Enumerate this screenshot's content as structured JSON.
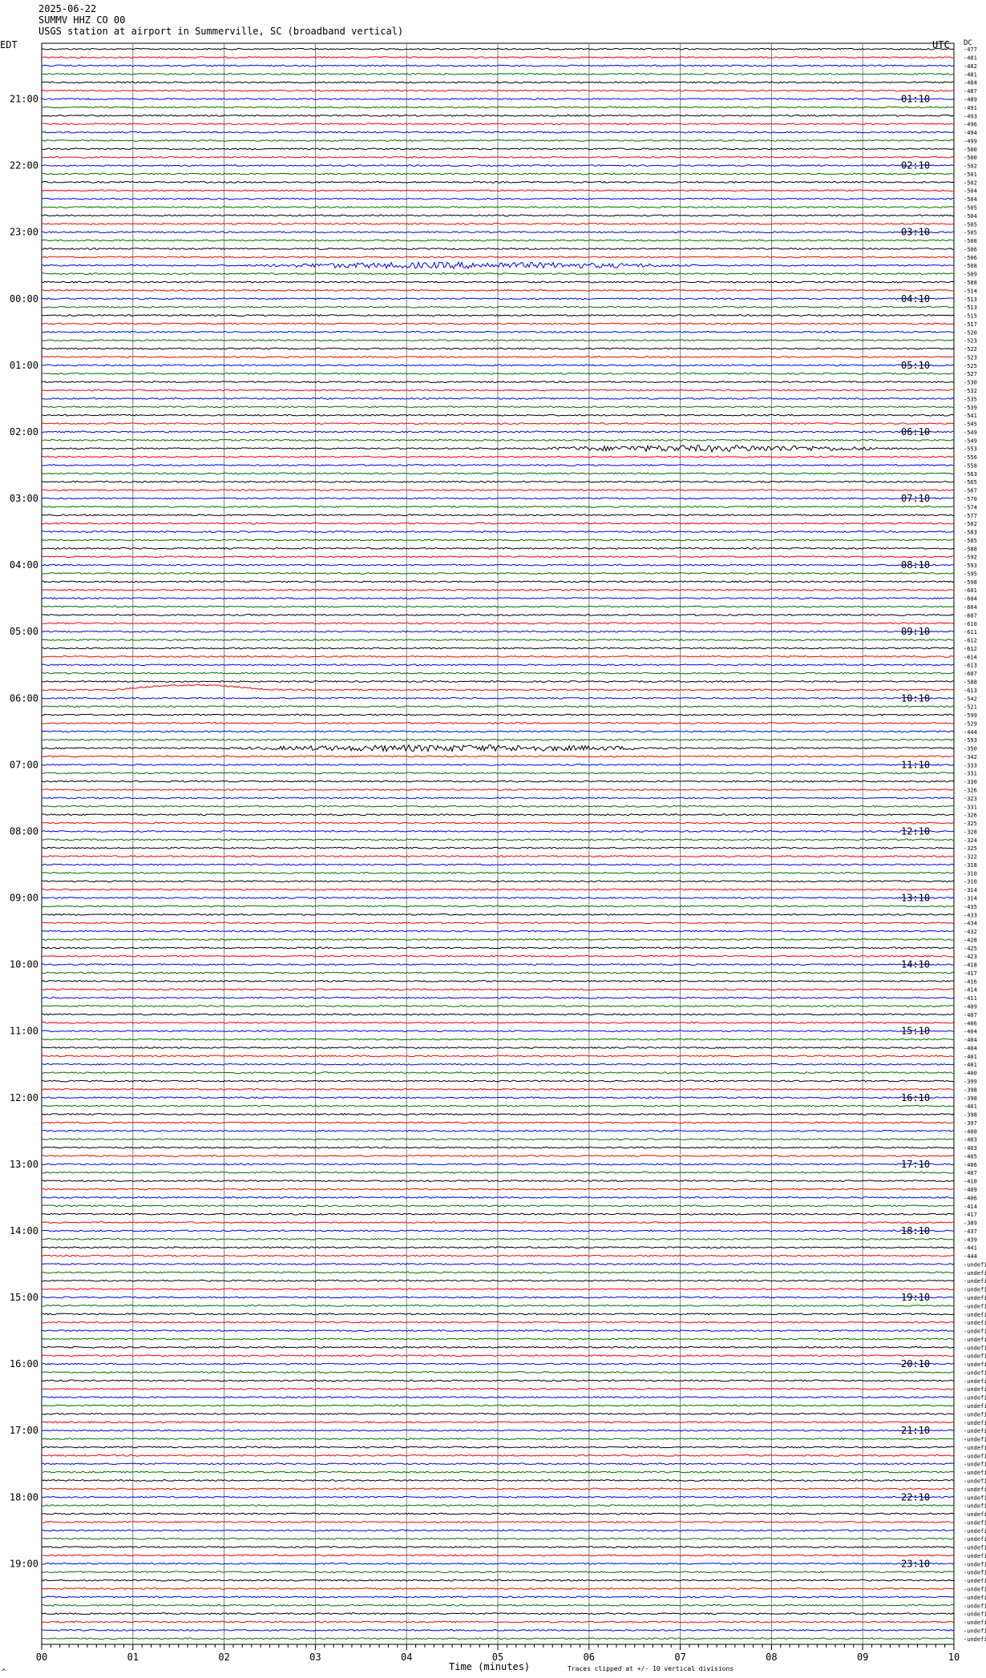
{
  "header": {
    "date": "2025-06-22",
    "station": "SUMMV HHZ CO 00",
    "description": "USGS station at airport in Summerville, SC (broadband vertical)"
  },
  "timezones": {
    "left": "EDT",
    "right": "UTC",
    "dc_label": "DC"
  },
  "xaxis": {
    "title": "Time (minutes)",
    "ticks": [
      "00",
      "01",
      "02",
      "03",
      "04",
      "05",
      "06",
      "07",
      "08",
      "09",
      "10"
    ]
  },
  "note": "Traces clipped at +/- 10 vertical divisions",
  "corner_mark": "^",
  "colors": {
    "cycle": [
      "#000000",
      "#ff0000",
      "#0000ff",
      "#007000"
    ],
    "grid": "#808080"
  },
  "chart_data": {
    "type": "line",
    "title": "",
    "rows": 192,
    "minutes_per_row": 10,
    "xlim": [
      0,
      10
    ],
    "left_hour_labels": [
      "21:00",
      "22:00",
      "23:00",
      "00:00",
      "01:00",
      "02:00",
      "03:00",
      "04:00",
      "05:00",
      "06:00",
      "07:00",
      "08:00",
      "09:00",
      "10:00",
      "11:00",
      "12:00",
      "13:00",
      "14:00",
      "15:00",
      "16:00",
      "17:00",
      "18:00",
      "19:00"
    ],
    "right_hour_labels": [
      "01:10",
      "02:10",
      "03:10",
      "04:10",
      "05:10",
      "06:10",
      "07:10",
      "08:10",
      "09:10",
      "10:10",
      "11:10",
      "12:10",
      "13:10",
      "14:10",
      "15:10",
      "16:10",
      "17:10",
      "18:10",
      "19:10",
      "20:10",
      "21:10",
      "22:10",
      "23:10"
    ],
    "dc_offsets": [
      "477",
      "481",
      "482",
      "481",
      "484",
      "487",
      "489",
      "491",
      "493",
      "496",
      "494",
      "499",
      "500",
      "500",
      "502",
      "501",
      "502",
      "504",
      "504",
      "505",
      "504",
      "505",
      "505",
      "508",
      "506",
      "506",
      "508",
      "509",
      "508",
      "514",
      "513",
      "513",
      "515",
      "517",
      "520",
      "523",
      "522",
      "523",
      "525",
      "527",
      "530",
      "532",
      "535",
      "539",
      "541",
      "545",
      "549",
      "549",
      "553",
      "556",
      "558",
      "563",
      "565",
      "567",
      "570",
      "574",
      "577",
      "582",
      "583",
      "585",
      "588",
      "592",
      "593",
      "595",
      "598",
      "601",
      "604",
      "604",
      "607",
      "610",
      "611",
      "612",
      "612",
      "614",
      "613",
      "607",
      "588",
      "613",
      "542",
      "521",
      "599",
      "529",
      "444",
      "593",
      "350",
      "342",
      "333",
      "331",
      "330",
      "326",
      "323",
      "331",
      "326",
      "325",
      "328",
      "324",
      "325",
      "322",
      "318",
      "310",
      "310",
      "314",
      "314",
      "435",
      "433",
      "434",
      "432",
      "428",
      "425",
      "423",
      "418",
      "417",
      "416",
      "414",
      "411",
      "409",
      "407",
      "406",
      "404",
      "404",
      "404",
      "401",
      "401",
      "400",
      "399",
      "398",
      "398",
      "401",
      "398",
      "397",
      "400",
      "403",
      "403",
      "405",
      "406",
      "407",
      "410",
      "409",
      "406",
      "414",
      "417",
      "389",
      "437",
      "439",
      "441",
      "444"
    ],
    "events": [
      {
        "row": 26,
        "start_min": 2.2,
        "end_min": 7.2,
        "kind": "noise burst"
      },
      {
        "row": 48,
        "start_min": 5.3,
        "end_min": 9.4,
        "kind": "noise burst"
      },
      {
        "row": 77,
        "start_min": 0.8,
        "end_min": 2.5,
        "kind": "long-period bump"
      },
      {
        "row": 84,
        "start_min": 2.0,
        "end_min": 7.0,
        "kind": "noise burst"
      }
    ]
  }
}
